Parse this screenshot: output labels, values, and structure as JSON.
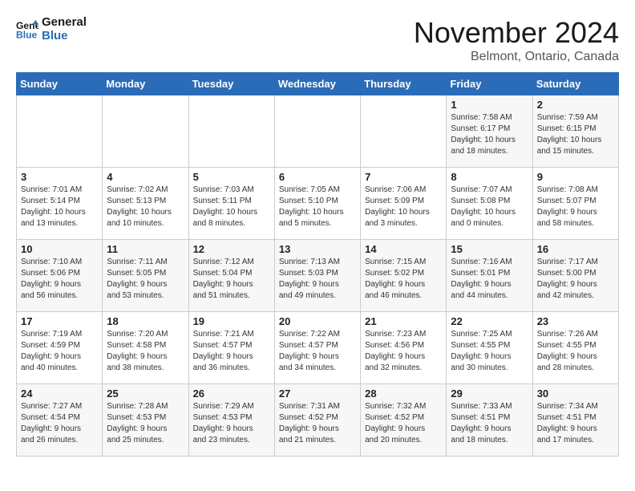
{
  "header": {
    "logo_line1": "General",
    "logo_line2": "Blue",
    "month": "November 2024",
    "location": "Belmont, Ontario, Canada"
  },
  "weekdays": [
    "Sunday",
    "Monday",
    "Tuesday",
    "Wednesday",
    "Thursday",
    "Friday",
    "Saturday"
  ],
  "weeks": [
    [
      {
        "day": "",
        "info": ""
      },
      {
        "day": "",
        "info": ""
      },
      {
        "day": "",
        "info": ""
      },
      {
        "day": "",
        "info": ""
      },
      {
        "day": "",
        "info": ""
      },
      {
        "day": "1",
        "info": "Sunrise: 7:58 AM\nSunset: 6:17 PM\nDaylight: 10 hours\nand 18 minutes."
      },
      {
        "day": "2",
        "info": "Sunrise: 7:59 AM\nSunset: 6:15 PM\nDaylight: 10 hours\nand 15 minutes."
      }
    ],
    [
      {
        "day": "3",
        "info": "Sunrise: 7:01 AM\nSunset: 5:14 PM\nDaylight: 10 hours\nand 13 minutes."
      },
      {
        "day": "4",
        "info": "Sunrise: 7:02 AM\nSunset: 5:13 PM\nDaylight: 10 hours\nand 10 minutes."
      },
      {
        "day": "5",
        "info": "Sunrise: 7:03 AM\nSunset: 5:11 PM\nDaylight: 10 hours\nand 8 minutes."
      },
      {
        "day": "6",
        "info": "Sunrise: 7:05 AM\nSunset: 5:10 PM\nDaylight: 10 hours\nand 5 minutes."
      },
      {
        "day": "7",
        "info": "Sunrise: 7:06 AM\nSunset: 5:09 PM\nDaylight: 10 hours\nand 3 minutes."
      },
      {
        "day": "8",
        "info": "Sunrise: 7:07 AM\nSunset: 5:08 PM\nDaylight: 10 hours\nand 0 minutes."
      },
      {
        "day": "9",
        "info": "Sunrise: 7:08 AM\nSunset: 5:07 PM\nDaylight: 9 hours\nand 58 minutes."
      }
    ],
    [
      {
        "day": "10",
        "info": "Sunrise: 7:10 AM\nSunset: 5:06 PM\nDaylight: 9 hours\nand 56 minutes."
      },
      {
        "day": "11",
        "info": "Sunrise: 7:11 AM\nSunset: 5:05 PM\nDaylight: 9 hours\nand 53 minutes."
      },
      {
        "day": "12",
        "info": "Sunrise: 7:12 AM\nSunset: 5:04 PM\nDaylight: 9 hours\nand 51 minutes."
      },
      {
        "day": "13",
        "info": "Sunrise: 7:13 AM\nSunset: 5:03 PM\nDaylight: 9 hours\nand 49 minutes."
      },
      {
        "day": "14",
        "info": "Sunrise: 7:15 AM\nSunset: 5:02 PM\nDaylight: 9 hours\nand 46 minutes."
      },
      {
        "day": "15",
        "info": "Sunrise: 7:16 AM\nSunset: 5:01 PM\nDaylight: 9 hours\nand 44 minutes."
      },
      {
        "day": "16",
        "info": "Sunrise: 7:17 AM\nSunset: 5:00 PM\nDaylight: 9 hours\nand 42 minutes."
      }
    ],
    [
      {
        "day": "17",
        "info": "Sunrise: 7:19 AM\nSunset: 4:59 PM\nDaylight: 9 hours\nand 40 minutes."
      },
      {
        "day": "18",
        "info": "Sunrise: 7:20 AM\nSunset: 4:58 PM\nDaylight: 9 hours\nand 38 minutes."
      },
      {
        "day": "19",
        "info": "Sunrise: 7:21 AM\nSunset: 4:57 PM\nDaylight: 9 hours\nand 36 minutes."
      },
      {
        "day": "20",
        "info": "Sunrise: 7:22 AM\nSunset: 4:57 PM\nDaylight: 9 hours\nand 34 minutes."
      },
      {
        "day": "21",
        "info": "Sunrise: 7:23 AM\nSunset: 4:56 PM\nDaylight: 9 hours\nand 32 minutes."
      },
      {
        "day": "22",
        "info": "Sunrise: 7:25 AM\nSunset: 4:55 PM\nDaylight: 9 hours\nand 30 minutes."
      },
      {
        "day": "23",
        "info": "Sunrise: 7:26 AM\nSunset: 4:55 PM\nDaylight: 9 hours\nand 28 minutes."
      }
    ],
    [
      {
        "day": "24",
        "info": "Sunrise: 7:27 AM\nSunset: 4:54 PM\nDaylight: 9 hours\nand 26 minutes."
      },
      {
        "day": "25",
        "info": "Sunrise: 7:28 AM\nSunset: 4:53 PM\nDaylight: 9 hours\nand 25 minutes."
      },
      {
        "day": "26",
        "info": "Sunrise: 7:29 AM\nSunset: 4:53 PM\nDaylight: 9 hours\nand 23 minutes."
      },
      {
        "day": "27",
        "info": "Sunrise: 7:31 AM\nSunset: 4:52 PM\nDaylight: 9 hours\nand 21 minutes."
      },
      {
        "day": "28",
        "info": "Sunrise: 7:32 AM\nSunset: 4:52 PM\nDaylight: 9 hours\nand 20 minutes."
      },
      {
        "day": "29",
        "info": "Sunrise: 7:33 AM\nSunset: 4:51 PM\nDaylight: 9 hours\nand 18 minutes."
      },
      {
        "day": "30",
        "info": "Sunrise: 7:34 AM\nSunset: 4:51 PM\nDaylight: 9 hours\nand 17 minutes."
      }
    ]
  ]
}
